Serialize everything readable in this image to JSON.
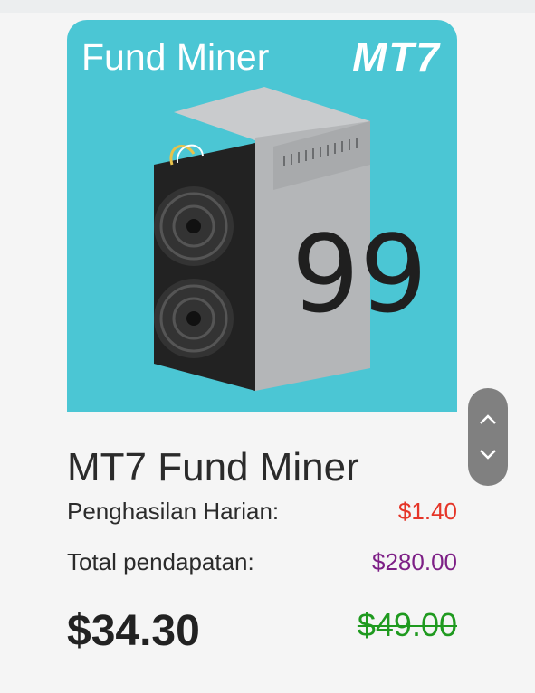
{
  "product": {
    "banner_title": "Fund Miner",
    "banner_model": "MT7",
    "hashrate_label": "99",
    "name": "MT7 Fund Miner",
    "daily_income_label": "Penghasilan Harian:",
    "daily_income_value": "$1.40",
    "total_income_label": "Total pendapatan:",
    "total_income_value": "$280.00",
    "price": "$34.30",
    "original_price": "$49.00"
  },
  "scroll_controls": {
    "up_icon": "chevron-up-icon",
    "down_icon": "chevron-down-icon"
  },
  "colors": {
    "banner_bg": "#4bc6d4",
    "daily_value": "#e53528",
    "total_value": "#7d1f86",
    "original_price": "#1f9a1f"
  }
}
